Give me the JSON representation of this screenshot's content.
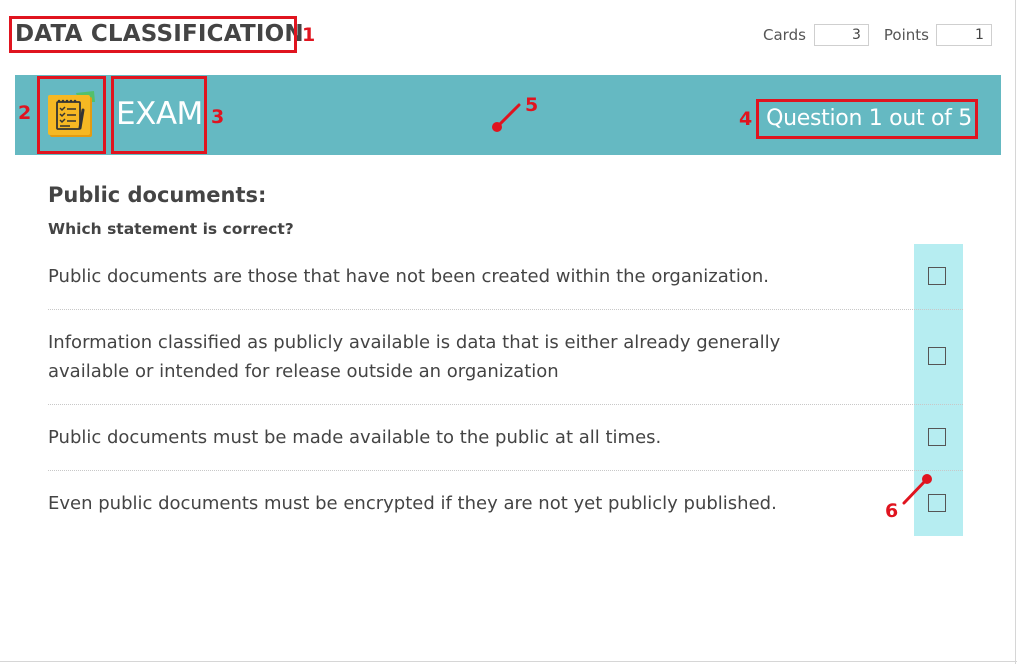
{
  "header": {
    "title": "DATA CLASSIFICATION",
    "cards_label": "Cards",
    "cards_value": "3",
    "points_label": "Points",
    "points_value": "1"
  },
  "banner": {
    "mode_label": "EXAM",
    "question_counter": "Question 1 out of 5",
    "color": "#65b9c2",
    "icon": "notepad-checklist-icon"
  },
  "question": {
    "title": "Public documents:",
    "prompt": "Which statement is correct?",
    "answers": [
      {
        "text": "Public documents are those that have not been created within the organization.",
        "checked": false
      },
      {
        "text": "Information classified as publicly available is data that is either already generally available or intended for release outside an organization",
        "checked": false
      },
      {
        "text": "Public documents must be made available to the public at all times.",
        "checked": false
      },
      {
        "text": "Even public documents must be encrypted if they are not yet publicly published.",
        "checked": false
      }
    ]
  },
  "annotations": {
    "color": "#e0141f",
    "numbers": [
      "1",
      "2",
      "3",
      "4",
      "5",
      "6"
    ]
  }
}
